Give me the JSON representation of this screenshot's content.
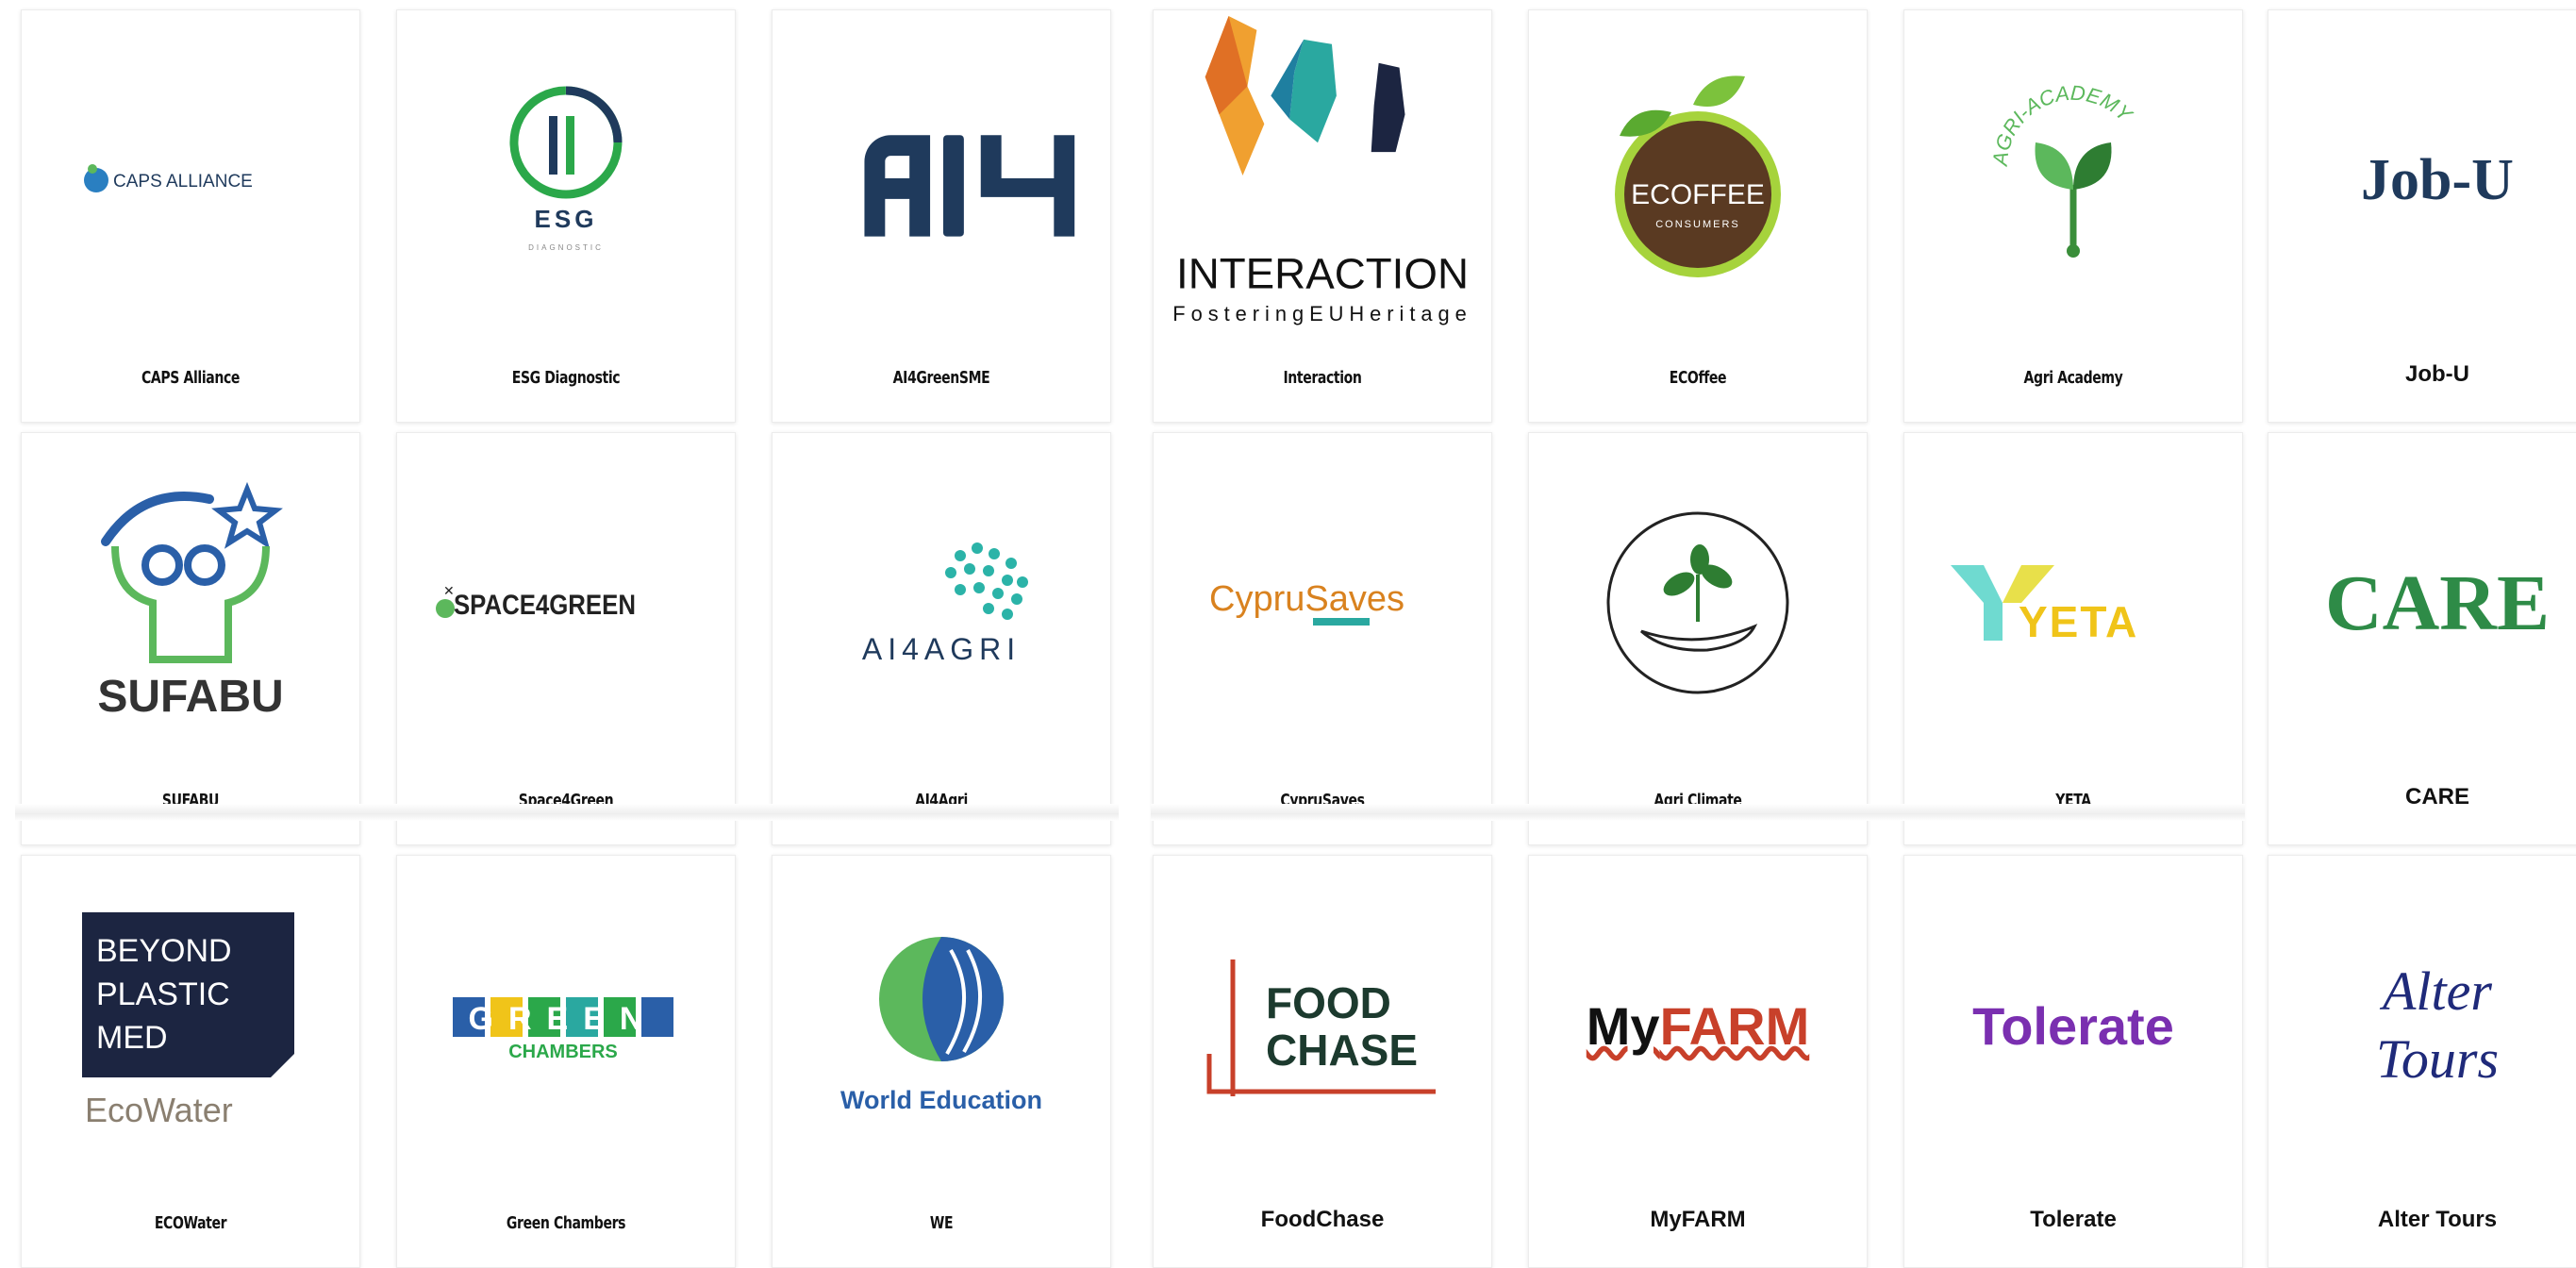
{
  "cards": [
    {
      "label": "CAPS Alliance",
      "logo_text": "CAPS ALLIANCE",
      "icon": "caps-alliance-logo"
    },
    {
      "label": "ESG Diagnostic",
      "logo_text": "ESG",
      "logo_subtext": "DIAGNOSTIC",
      "icon": "esg-logo"
    },
    {
      "label": "AI4GreenSME",
      "icon": "ai4-logo"
    },
    {
      "label": "Interaction",
      "logo_text": "INTERACTION",
      "logo_subtext": "FosteringEUHeritage",
      "icon": "interaction-faces-logo"
    },
    {
      "label": "ECOffee",
      "logo_text": "ECOFFEE",
      "logo_subtext": "CONSUMERS",
      "icon": "ecoffee-logo"
    },
    {
      "label": "Agri Academy",
      "logo_text": "AGRI-ACADEMY",
      "icon": "agri-academy-sprout-logo"
    },
    {
      "label": "Job-U",
      "logo_text": "Job-U",
      "icon": "job-u-logo"
    },
    {
      "label": "SUFABU",
      "logo_text": "SUFABU",
      "icon": "sufabu-logo"
    },
    {
      "label": "Space4Green",
      "logo_text": "SPACE4GREEN",
      "icon": "space4green-logo"
    },
    {
      "label": "AI4Agri",
      "logo_text": "AI4AGRI",
      "icon": "ai4agri-brain-logo"
    },
    {
      "label": "CypruSaves",
      "logo_text": "CypruSaves",
      "icon": "cyprusaves-logo"
    },
    {
      "label": "Agri Climate",
      "icon": "agri-climate-hand-plant-logo"
    },
    {
      "label": "YETA",
      "logo_text": "YETA",
      "icon": "yeta-logo"
    },
    {
      "label": "CARE",
      "logo_text": "CARE",
      "icon": "care-logo"
    },
    {
      "label": "ECOWater",
      "logo_text": "BEYOND PLASTIC MED",
      "logo_subtext": "EcoWater",
      "icon": "ecowater-logo"
    },
    {
      "label": "Green Chambers",
      "logo_text": "GREEN",
      "logo_subtext": "CHAMBERS",
      "icon": "green-chambers-logo"
    },
    {
      "label": "WE",
      "logo_text": "World Education",
      "icon": "world-education-globe-logo"
    },
    {
      "label": "FoodChase",
      "logo_text": "FOOD CHASE",
      "icon": "foodchase-logo"
    },
    {
      "label": "MyFARM",
      "logo_text": "MyFARM",
      "icon": "myfarm-logo"
    },
    {
      "label": "Tolerate",
      "logo_text": "Tolerate",
      "icon": "tolerate-logo"
    },
    {
      "label": "Alter Tours",
      "logo_text": "Alter Tours",
      "icon": "alter-tours-logo"
    }
  ],
  "colors": {
    "navy": "#1f3a5c",
    "green": "#2e9a47",
    "purple": "#7a2fb0",
    "red": "#c8402a",
    "teal": "#2aa8a0",
    "dark": "#1c2541"
  }
}
